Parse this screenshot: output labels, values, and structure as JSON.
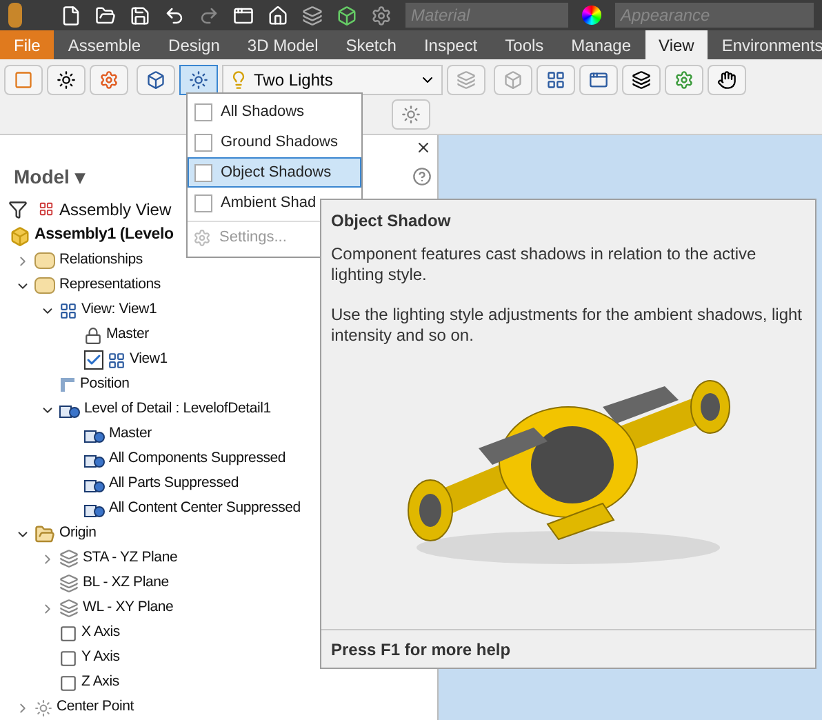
{
  "quick_access": {
    "material": {
      "placeholder": "Material"
    },
    "appearance": {
      "placeholder": "Appearance"
    }
  },
  "tabs": [
    {
      "label": "File",
      "kind": "file",
      "selected": false
    },
    {
      "label": "Assemble",
      "kind": "tab",
      "selected": false
    },
    {
      "label": "Design",
      "kind": "tab",
      "selected": false
    },
    {
      "label": "3D Model",
      "kind": "tab",
      "selected": false
    },
    {
      "label": "Sketch",
      "kind": "tab",
      "selected": false
    },
    {
      "label": "Inspect",
      "kind": "tab",
      "selected": false
    },
    {
      "label": "Tools",
      "kind": "tab",
      "selected": false
    },
    {
      "label": "Manage",
      "kind": "tab",
      "selected": false
    },
    {
      "label": "View",
      "kind": "tab",
      "selected": true
    },
    {
      "label": "Environments",
      "kind": "tab",
      "selected": false
    }
  ],
  "ribbon": {
    "lighting": {
      "value": "Two Lights"
    }
  },
  "shadows_menu": {
    "items": [
      {
        "label": "All Shadows",
        "kind": "checkbox",
        "checked": false,
        "selected": false
      },
      {
        "label": "Ground Shadows",
        "kind": "checkbox",
        "checked": false,
        "selected": false
      },
      {
        "label": "Object Shadows",
        "kind": "checkbox",
        "checked": false,
        "selected": true
      },
      {
        "label": "Ambient Shad",
        "kind": "checkbox",
        "checked": false,
        "selected": false
      },
      {
        "label": "Settings...",
        "kind": "command",
        "disabled": true
      }
    ]
  },
  "browser": {
    "title": "Model ▾",
    "view": "Assembly View",
    "tree": [
      {
        "label": "Assembly1 (Levelo",
        "kind": "assembly",
        "children": [
          {
            "label": "Relationships",
            "kind": "folder",
            "expanded": false
          },
          {
            "label": "Representations",
            "kind": "folder",
            "expanded": true,
            "children": [
              {
                "label": "View: View1",
                "kind": "view",
                "expanded": true,
                "children": [
                  {
                    "label": "Master",
                    "kind": "lock"
                  },
                  {
                    "label": "View1",
                    "kind": "view",
                    "checked": true
                  }
                ]
              },
              {
                "label": "Position",
                "kind": "position"
              },
              {
                "label": "Level of Detail : LevelofDetail1",
                "kind": "lod",
                "expanded": true,
                "children": [
                  {
                    "label": "Master",
                    "kind": "lod"
                  },
                  {
                    "label": "All Components Suppressed",
                    "kind": "lod"
                  },
                  {
                    "label": "All Parts Suppressed",
                    "kind": "lod"
                  },
                  {
                    "label": "All Content Center Suppressed",
                    "kind": "lod"
                  }
                ]
              }
            ]
          },
          {
            "label": "Origin",
            "kind": "open-folder",
            "expanded": true,
            "children": [
              {
                "label": "STA - YZ Plane",
                "kind": "plane",
                "expanded": false
              },
              {
                "label": "BL - XZ Plane",
                "kind": "plane"
              },
              {
                "label": "WL - XY Plane",
                "kind": "plane",
                "expanded": false
              },
              {
                "label": "X Axis",
                "kind": "axis"
              },
              {
                "label": "Y Axis",
                "kind": "axis"
              },
              {
                "label": "Z Axis",
                "kind": "axis"
              }
            ]
          },
          {
            "label": "Center Point",
            "kind": "point",
            "expanded": false
          }
        ]
      }
    ]
  },
  "tooltip": {
    "title": "Object Shadow",
    "paragraphs": [
      "Component features cast shadows in relation to the active lighting style.",
      "Use the lighting style adjustments for the ambient shadows, light intensity and so on."
    ],
    "footer": "Press F1 for more help"
  }
}
